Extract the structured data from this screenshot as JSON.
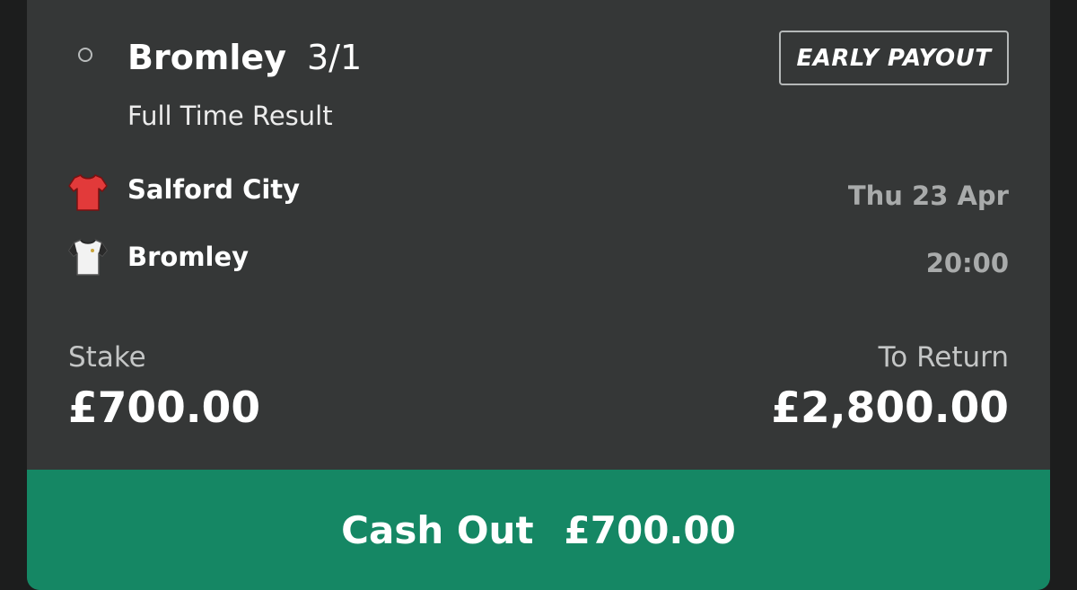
{
  "bet": {
    "selection": "Bromley",
    "odds": "3/1",
    "early_payout_label": "EARLY PAYOUT",
    "market": "Full Time Result"
  },
  "match": {
    "home_team": "Salford City",
    "away_team": "Bromley",
    "date": "Thu 23 Apr",
    "time": "20:00",
    "home_kit_icon": "red-shirt-icon",
    "away_kit_icon": "white-shirt-icon"
  },
  "summary": {
    "stake_label": "Stake",
    "stake_value": "£700.00",
    "return_label": "To Return",
    "return_value": "£2,800.00"
  },
  "cash_out": {
    "label": "Cash Out",
    "amount": "£700.00"
  },
  "colors": {
    "background": "#1c1d1d",
    "card": "#353737",
    "cash_out_green": "#158764",
    "muted_text": "#a9abab",
    "home_kit": "#e23a3a",
    "away_kit": "#f2f2f2"
  }
}
